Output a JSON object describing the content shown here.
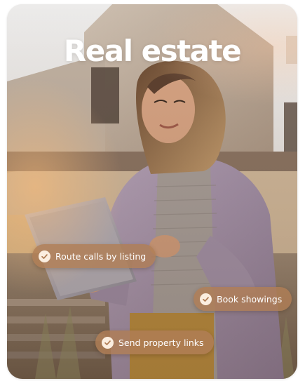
{
  "hero": {
    "title": "Real estate"
  },
  "features": [
    {
      "label": "Route calls by listing",
      "icon": "check-circle-icon"
    },
    {
      "label": "Book showings",
      "icon": "check-circle-icon"
    },
    {
      "label": "Send property links",
      "icon": "check-circle-icon"
    }
  ],
  "colors": {
    "pill_background": "#b07e56",
    "check_background": "#fbeee0",
    "check_mark": "#b07e56",
    "title_text": "#ffffff"
  }
}
